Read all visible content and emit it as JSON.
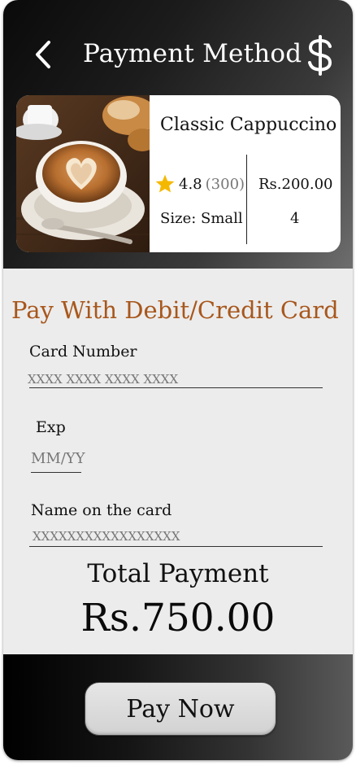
{
  "header": {
    "title": "Payment Method",
    "back_icon": "chevron-left-icon",
    "currency_icon": "dollar-icon"
  },
  "product": {
    "name": "Classic Cappuccino",
    "rating": "4.8",
    "rating_count": "(300)",
    "size": "Size: Small",
    "price": "Rs.200.00",
    "quantity": "4",
    "image": "cappuccino-latte-art-photo"
  },
  "payment_form": {
    "title": "Pay With Debit/Credit Card",
    "card_number_label": "Card Number",
    "card_number_placeholder": "XXXX XXXX XXXX XXXX",
    "exp_label": "Exp",
    "exp_placeholder": "MM/YY",
    "name_label": "Name on the card",
    "name_placeholder": "XXXXXXXXXXXXXXXXX"
  },
  "total": {
    "label": "Total Payment",
    "amount": "Rs.750.00"
  },
  "footer": {
    "pay_button_label": "Pay Now"
  },
  "colors": {
    "accent": "#a8571c",
    "star": "#f5b800",
    "header_bg": "#1c1c1c",
    "content_bg": "#ececec"
  }
}
